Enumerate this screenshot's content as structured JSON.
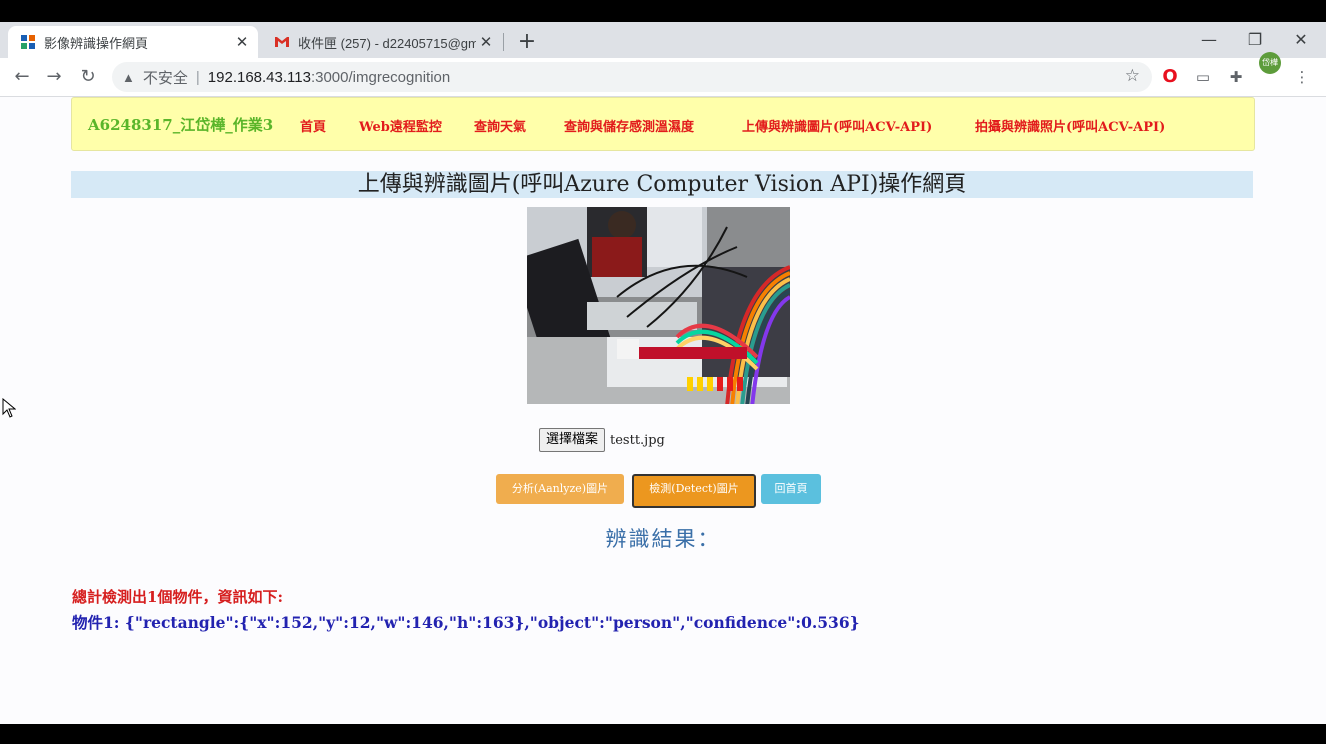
{
  "browser": {
    "tabs": [
      {
        "title": "影像辨識操作網頁",
        "active": true,
        "close": "✕"
      },
      {
        "title": "收件匣 (257) - d22405715@gm",
        "active": false,
        "close": "✕"
      }
    ],
    "new_tab": "+",
    "window_controls": {
      "minimize": "—",
      "restore": "❐",
      "close": "✕"
    },
    "nav": {
      "back": "←",
      "forward": "→",
      "reload": "↻"
    },
    "address": {
      "warning_icon": "▲",
      "security_text": "不安全",
      "separator": "|",
      "host": "192.168.43.113",
      "path": ":3000/imgrecognition",
      "star": "☆"
    },
    "extensions": {
      "opera": "O",
      "ext2": "▭",
      "puzzle": "✚",
      "avatar": "岱樺",
      "menu": "⋮"
    }
  },
  "navbar": {
    "brand": "A6248317_江岱樺_作業3",
    "links": [
      "首頁",
      "Web遠程監控",
      "查詢天氣",
      "查詢與儲存感測溫濕度",
      "上傳與辨識圖片(呼叫ACV-API)",
      "拍攝與辨識照片(呼叫ACV-API)"
    ]
  },
  "page": {
    "heading": "上傳與辨識圖片(呼叫Azure Computer Vision API)操作網頁",
    "file_button": "選擇檔案",
    "file_name": "testt.jpg",
    "buttons": {
      "analyze": "分析(Aanlyze)圖片",
      "detect": "檢測(Detect)圖片",
      "home": "回首頁"
    },
    "result_title": "辨識結果：",
    "summary": "總計檢測出1個物件，資訊如下:",
    "object_line": "物件1: {\"rectangle\":{\"x\":152,\"y\":12,\"w\":146,\"h\":163},\"object\":\"person\",\"confidence\":0.536}"
  },
  "colors": {
    "navbar_bg": "#ffffaa",
    "brand": "#5ab52a",
    "nav_link": "#e21c1c",
    "heading_bg": "#d6e9f6",
    "analyze_btn": "#f0ad4e",
    "detect_btn": "#ec971f",
    "home_btn": "#5bc0de",
    "summary": "#d61f1f",
    "object_line": "#2323b0"
  }
}
